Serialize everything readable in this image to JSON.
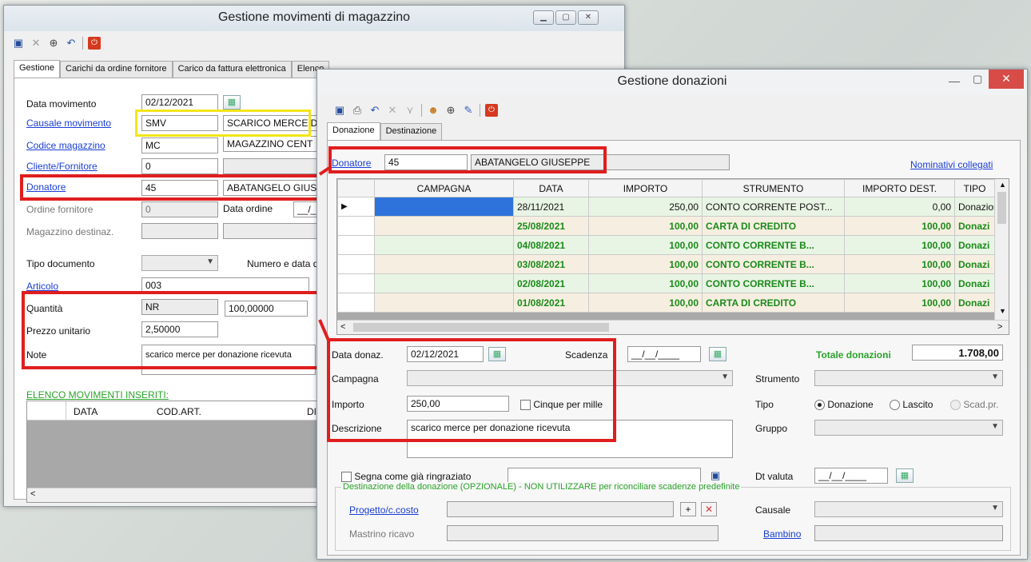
{
  "back_window": {
    "title": "Gestione movimenti di magazzino",
    "tabs": [
      "Gestione",
      "Carichi da ordine fornitore",
      "Carico da fattura elettronica",
      "Elenco"
    ],
    "fields": {
      "data_movimento_label": "Data movimento",
      "data_movimento_value": "02/12/2021",
      "causale_label": "Causale movimento",
      "causale_code": "SMV",
      "causale_desc": "SCARICO MERCE D",
      "magazzino_label": "Codice magazzino",
      "magazzino_code": "MC",
      "magazzino_desc": "MAGAZZINO CENT",
      "cliente_label": "Cliente/Fornitore",
      "cliente_value": "0",
      "donatore_label": "Donatore",
      "donatore_code": "45",
      "donatore_desc": "ABATANGELO GIUS",
      "ordine_label": "Ordine fornitore",
      "ordine_value": "0",
      "data_ordine_label": "Data ordine",
      "data_ordine_value": "__/_",
      "mag_dest_label": "Magazzino destinaz.",
      "tipo_doc_label": "Tipo documento",
      "numero_data_label": "Numero e data d",
      "articolo_label": "Articolo",
      "articolo_value": "003",
      "quantita_label": "Quantità",
      "quantita_um": "NR",
      "quantita_value": "100,00000",
      "prezzo_label": "Prezzo unitario",
      "prezzo_value": "2,50000",
      "note_label": "Note",
      "note_value": "scarico merce per donazione ricevuta"
    },
    "list_title": "ELENCO MOVIMENTI INSERITI:",
    "list_headers": [
      "DATA",
      "COD.ART.",
      "DI"
    ]
  },
  "front_window": {
    "title": "Gestione donazioni",
    "tabs": [
      "Donazione",
      "Destinazione"
    ],
    "donatore_label": "Donatore",
    "donatore_code": "45",
    "donatore_name": "ABATANGELO GIUSEPPE",
    "nominativi_link": "Nominativi collegati",
    "grid_headers": [
      "CAMPAGNA",
      "DATA",
      "IMPORTO",
      "STRUMENTO",
      "IMPORTO DEST.",
      "TIPO"
    ],
    "grid_rows": [
      {
        "campagna": "",
        "data": "28/11/2021",
        "importo": "250,00",
        "strumento": "CONTO CORRENTE POST...",
        "importo_dest": "0,00",
        "tipo": "Donazior"
      },
      {
        "campagna": "",
        "data": "25/08/2021",
        "importo": "100,00",
        "strumento": "CARTA DI CREDITO",
        "importo_dest": "100,00",
        "tipo": "Donazi"
      },
      {
        "campagna": "",
        "data": "04/08/2021",
        "importo": "100,00",
        "strumento": "CONTO CORRENTE B...",
        "importo_dest": "100,00",
        "tipo": "Donazi"
      },
      {
        "campagna": "",
        "data": "03/08/2021",
        "importo": "100,00",
        "strumento": "CONTO CORRENTE B...",
        "importo_dest": "100,00",
        "tipo": "Donazi"
      },
      {
        "campagna": "",
        "data": "02/08/2021",
        "importo": "100,00",
        "strumento": "CONTO CORRENTE B...",
        "importo_dest": "100,00",
        "tipo": "Donazi"
      },
      {
        "campagna": "",
        "data": "01/08/2021",
        "importo": "100,00",
        "strumento": "CARTA DI CREDITO",
        "importo_dest": "100,00",
        "tipo": "Donazi"
      }
    ],
    "form": {
      "data_donaz_label": "Data donaz.",
      "data_donaz_value": "02/12/2021",
      "scadenza_label": "Scadenza",
      "scadenza_value": "__/__/____",
      "totale_label": "Totale donazioni",
      "totale_value": "1.708,00",
      "campagna_label": "Campagna",
      "strumento_label": "Strumento",
      "importo_label": "Importo",
      "importo_value": "250,00",
      "cinque_label": "Cinque per mille",
      "tipo_label": "Tipo",
      "radio_donazione": "Donazione",
      "radio_lascito": "Lascito",
      "radio_scad": "Scad.pr.",
      "descrizione_label": "Descrizione",
      "descrizione_value": "scarico merce per donazione ricevuta",
      "gruppo_label": "Gruppo",
      "segna_label": "Segna come già ringraziato",
      "dt_valuta_label": "Dt valuta",
      "dt_valuta_value": "__/__/____",
      "destinazione_caption": "Destinazione della donazione (OPZIONALE) - NON UTILIZZARE per riconciliare scadenze predefinite",
      "progetto_label": "Progetto/c.costo",
      "causale_label": "Causale",
      "mastrino_label": "Mastrino ricavo",
      "bambino_label": "Bambino"
    }
  },
  "colors": {
    "annotation_red": "#e01e1e",
    "annotation_yellow": "#f3e51b",
    "link_blue": "#1a3ed6",
    "green_text": "#1a8a1a"
  }
}
